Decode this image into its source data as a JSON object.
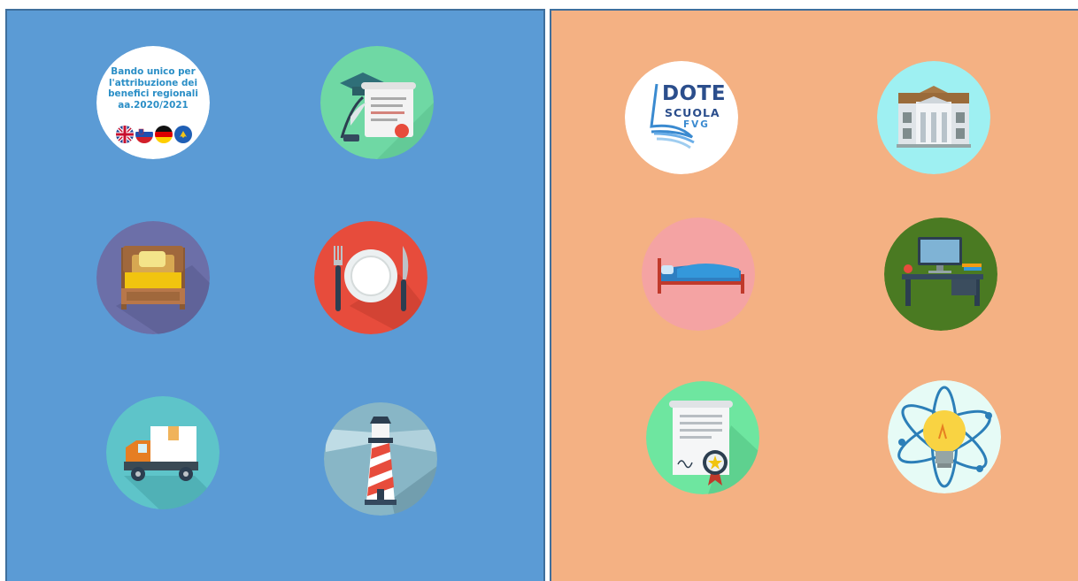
{
  "panels": {
    "left": {
      "background": "#5b9bd5"
    },
    "right": {
      "background": "#f4b183"
    }
  },
  "bando": {
    "line1": "Bando unico per",
    "line2": "l'attribuzione dei",
    "line3": "benefici regionali",
    "line4": "aa.2020/2021",
    "flags": [
      "uk-flag-icon",
      "slovenia-flag-icon",
      "germany-flag-icon",
      "friuli-flag-icon"
    ]
  },
  "dote": {
    "line1": "DOTE",
    "line2": "SCUOLA",
    "line3": "FVG"
  },
  "icons": {
    "left": [
      "bando-unico-icon",
      "graduation-diploma-icon",
      "bed-icon",
      "dining-plate-icon",
      "delivery-truck-icon",
      "lighthouse-icon"
    ],
    "right": [
      "dote-scuola-icon",
      "school-building-icon",
      "dormitory-bed-icon",
      "study-desk-icon",
      "certificate-icon",
      "science-lightbulb-icon"
    ]
  },
  "colors": {
    "graduation": "#6fd8a4",
    "bed": "#6c6fa8",
    "dining": "#e74c3c",
    "truck": "#5ec4c9",
    "lighthouse": "#88b6c6",
    "school": "#9ef0f2",
    "dormitory": "#f4a3a3",
    "desk": "#4a7a22",
    "certificate": "#6ee6a0",
    "science": "#e6fbf6"
  }
}
